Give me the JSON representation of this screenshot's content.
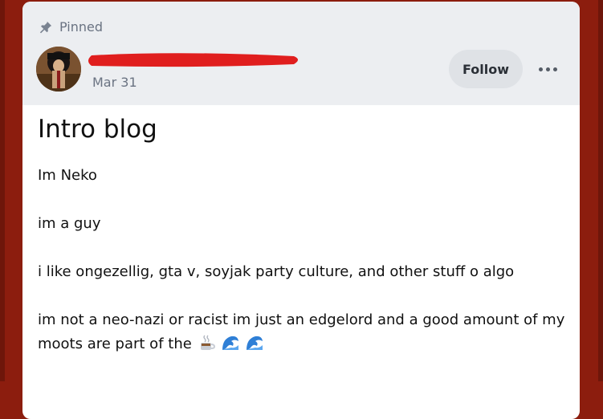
{
  "post": {
    "pinned_label": "Pinned",
    "date": "Mar 31",
    "follow_label": "Follow",
    "title": "Intro blog",
    "paragraphs": [
      "Im Neko",
      "im a guy",
      "i like ongezellig, gta v, soyjak party culture, and other stuff o algo",
      "im not a neo-nazi or racist im just an edgelord and a good amount of my moots are part of the"
    ],
    "trailing_emojis": [
      "hot-beverage-icon",
      "water-wave-icon",
      "water-wave-icon"
    ]
  },
  "colors": {
    "background": "#8c1d0e",
    "header": "#eceef1",
    "redaction": "#e01e1e",
    "muted_text": "#6a7382",
    "follow_button": "#dfe2e6",
    "wave": "#2f7fd6"
  }
}
